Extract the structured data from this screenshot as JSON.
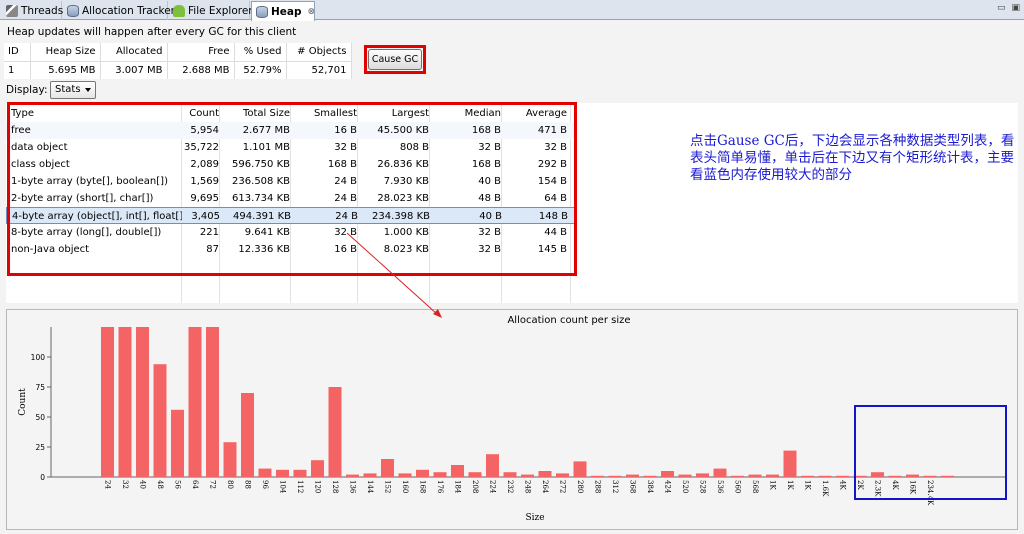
{
  "tabs": [
    {
      "label": "Threads",
      "icon": "threads-icon",
      "active": false
    },
    {
      "label": "Allocation Tracker",
      "icon": "cylinder-icon",
      "active": false
    },
    {
      "label": "File Explorer",
      "icon": "android-icon",
      "active": false
    },
    {
      "label": "Heap",
      "icon": "cylinder-icon",
      "active": true,
      "close": "⊗"
    }
  ],
  "window_controls": {
    "minimize": "▭",
    "maximize": "▣"
  },
  "heap_info": "Heap updates will happen after every GC for this client",
  "stats": {
    "headers": [
      "ID",
      "Heap Size",
      "Allocated",
      "Free",
      "% Used",
      "# Objects"
    ],
    "values": [
      "1",
      "5.695 MB",
      "3.007 MB",
      "2.688 MB",
      "52.79%",
      "52,701"
    ]
  },
  "cause_gc_label": "Cause GC",
  "display": {
    "label": "Display:",
    "selected": "Stats"
  },
  "table": {
    "headers": [
      "Type",
      "Count",
      "Total Size",
      "Smallest",
      "Largest",
      "Median",
      "Average"
    ],
    "rows": [
      [
        "free",
        "5,954",
        "2.677 MB",
        "16 B",
        "45.500 KB",
        "168 B",
        "471 B"
      ],
      [
        "data object",
        "35,722",
        "1.101 MB",
        "32 B",
        "808 B",
        "32 B",
        "32 B"
      ],
      [
        "class object",
        "2,089",
        "596.750 KB",
        "168 B",
        "26.836 KB",
        "168 B",
        "292 B"
      ],
      [
        "1-byte array (byte[], boolean[])",
        "1,569",
        "236.508 KB",
        "24 B",
        "7.930 KB",
        "40 B",
        "154 B"
      ],
      [
        "2-byte array (short[], char[])",
        "9,695",
        "613.734 KB",
        "24 B",
        "28.023 KB",
        "48 B",
        "64 B"
      ],
      [
        "4-byte array (object[], int[], float[])",
        "3,405",
        "494.391 KB",
        "24 B",
        "234.398 KB",
        "40 B",
        "148 B"
      ],
      [
        "8-byte array (long[], double[])",
        "221",
        "9.641 KB",
        "32 B",
        "1.000 KB",
        "32 B",
        "44 B"
      ],
      [
        "non-Java object",
        "87",
        "12.336 KB",
        "16 B",
        "8.023 KB",
        "32 B",
        "145 B"
      ]
    ],
    "selected_row": 5
  },
  "annotation": "点击Gause GC后，下边会显示各种数据类型列表，看表头简单易懂，单击后在下边又有个矩形统计表，主要看蓝色内存使用较大的部分",
  "colors": {
    "bar": "#f46464",
    "highlight_red": "#e20000",
    "highlight_blue": "#1515c8",
    "annotation_text": "#1a1ad0",
    "selection": "#dbe8f8"
  },
  "chart_data": {
    "type": "bar",
    "title": "Allocation count per size",
    "xlabel": "Size",
    "ylabel": "Count",
    "ylim": [
      0,
      125
    ],
    "yticks": [
      0,
      25,
      50,
      75,
      100
    ],
    "clipped_at_top": true,
    "categories": [
      "24",
      "32",
      "40",
      "48",
      "56",
      "64",
      "72",
      "80",
      "88",
      "96",
      "104",
      "112",
      "120",
      "128",
      "136",
      "144",
      "152",
      "160",
      "168",
      "176",
      "184",
      "208",
      "224",
      "232",
      "248",
      "264",
      "272",
      "280",
      "288",
      "312",
      "368",
      "384",
      "424",
      "520",
      "528",
      "536",
      "560",
      "568",
      "1K",
      "1K",
      "1K",
      "1.6K",
      "4K",
      "2K",
      "2.3K",
      "4K",
      "16K",
      "234.4K"
    ],
    "values": [
      125,
      125,
      125,
      94,
      56,
      125,
      125,
      29,
      70,
      7,
      6,
      6,
      14,
      75,
      2,
      3,
      15,
      3,
      6,
      4,
      10,
      4,
      19,
      4,
      2,
      5,
      3,
      13,
      1,
      1,
      2,
      1,
      5,
      2,
      3,
      7,
      1,
      2,
      2,
      22,
      1,
      1,
      1,
      1,
      4,
      1,
      2,
      1,
      1
    ]
  }
}
